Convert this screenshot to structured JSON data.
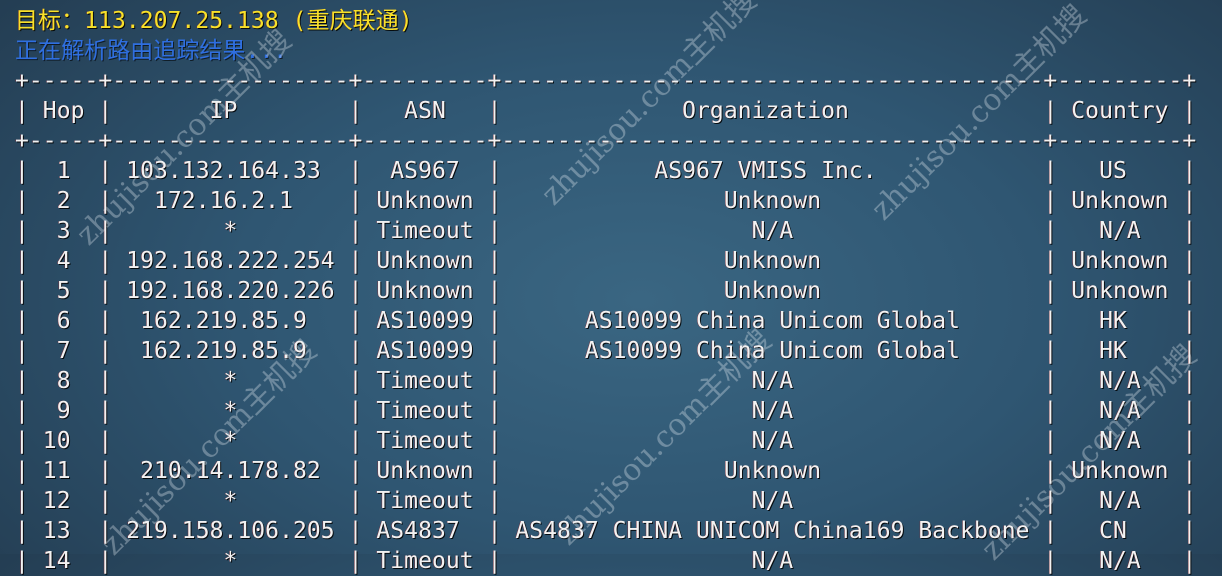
{
  "header": {
    "target_label": "目标：",
    "target_ip": "113.207.25.138",
    "target_location": "(重庆联通)",
    "status": "正在解析路由追踪结果..."
  },
  "table": {
    "columns": [
      {
        "key": "hop",
        "label": "Hop",
        "width": 5
      },
      {
        "key": "ip",
        "label": "IP",
        "width": 17
      },
      {
        "key": "asn",
        "label": "ASN",
        "width": 9
      },
      {
        "key": "org",
        "label": "Organization",
        "width": 39
      },
      {
        "key": "country",
        "label": "Country",
        "width": 9
      }
    ],
    "rows": [
      {
        "hop": "1",
        "ip": "103.132.164.33",
        "asn": "AS967",
        "org": "AS967 VMISS Inc.",
        "country": "US"
      },
      {
        "hop": "2",
        "ip": "172.16.2.1",
        "asn": "Unknown",
        "org": "Unknown",
        "country": "Unknown"
      },
      {
        "hop": "3",
        "ip": "*",
        "asn": "Timeout",
        "org": "N/A",
        "country": "N/A"
      },
      {
        "hop": "4",
        "ip": "192.168.222.254",
        "asn": "Unknown",
        "org": "Unknown",
        "country": "Unknown"
      },
      {
        "hop": "5",
        "ip": "192.168.220.226",
        "asn": "Unknown",
        "org": "Unknown",
        "country": "Unknown"
      },
      {
        "hop": "6",
        "ip": "162.219.85.9",
        "asn": "AS10099",
        "org": "AS10099 China Unicom Global",
        "country": "HK"
      },
      {
        "hop": "7",
        "ip": "162.219.85.9",
        "asn": "AS10099",
        "org": "AS10099 China Unicom Global",
        "country": "HK"
      },
      {
        "hop": "8",
        "ip": "*",
        "asn": "Timeout",
        "org": "N/A",
        "country": "N/A"
      },
      {
        "hop": "9",
        "ip": "*",
        "asn": "Timeout",
        "org": "N/A",
        "country": "N/A"
      },
      {
        "hop": "10",
        "ip": "*",
        "asn": "Timeout",
        "org": "N/A",
        "country": "N/A"
      },
      {
        "hop": "11",
        "ip": "210.14.178.82",
        "asn": "Unknown",
        "org": "Unknown",
        "country": "Unknown"
      },
      {
        "hop": "12",
        "ip": "*",
        "asn": "Timeout",
        "org": "N/A",
        "country": "N/A"
      },
      {
        "hop": "13",
        "ip": "219.158.106.205",
        "asn": "AS4837",
        "org": "AS4837 CHINA UNICOM China169 Backbone",
        "country": "CN"
      },
      {
        "hop": "14",
        "ip": "*",
        "asn": "Timeout",
        "org": "N/A",
        "country": "N/A"
      }
    ]
  },
  "watermark": {
    "text": "zhujisou.com主机搜"
  },
  "colors": {
    "target_text": "#f7e12a",
    "status_text": "#2f6fe0",
    "table_text": "#f2f2f2"
  }
}
